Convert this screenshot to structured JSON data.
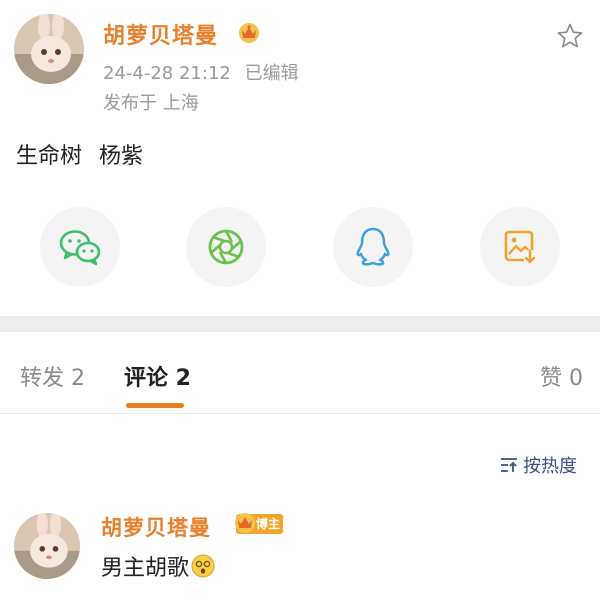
{
  "post": {
    "author_name": "胡萝贝塔曼",
    "timestamp": "24-4-28 21:12",
    "edited_label": "已编辑",
    "location": "发布于 上海",
    "text": "生命树 杨紫"
  },
  "share": {
    "icons": [
      "wechat-icon",
      "moments-icon",
      "qq-icon",
      "save-image-icon"
    ],
    "colors": {
      "wechat": "#3fbf6e",
      "moments": "#6bc24a",
      "qq": "#3aa0e0",
      "save": "#f0a32a"
    }
  },
  "tabs": {
    "repost": "转发 2",
    "comment": "评论 2",
    "like": "赞 0"
  },
  "sort": {
    "label": "按热度"
  },
  "comment": {
    "author_name": "胡萝贝塔曼",
    "badge": "博主",
    "text": "男主胡歌"
  },
  "colors": {
    "accent": "#ee7d1f",
    "name": "#e8802c",
    "meta": "#9b9b9b",
    "link": "#3d4f80"
  }
}
